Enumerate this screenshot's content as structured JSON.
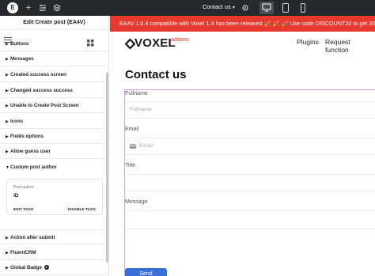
{
  "topbar": {
    "logo_letter": "E",
    "page_selector": "Contact us",
    "plus_icon": "+",
    "chevron": "▾"
  },
  "panel": {
    "title": "Edit Create post (EA4V)",
    "sections": [
      {
        "label": "Buttons"
      },
      {
        "label": "Messages"
      },
      {
        "label": "Created success screen"
      },
      {
        "label": "Changed success success"
      },
      {
        "label": "Unable to Create Post Screen"
      },
      {
        "label": "Icons"
      },
      {
        "label": "Fields options"
      },
      {
        "label": "Allow guess user"
      },
      {
        "label": "Custom post author",
        "expanded": true
      },
      {
        "label": "Action after submit"
      },
      {
        "label": "FluentCRM"
      },
      {
        "label": "Global Badge"
      }
    ],
    "card": {
      "label": "Post author",
      "value": "ID",
      "edit_tags": "EDIT TAGS",
      "disable_tags": "DISABLE TAGS"
    }
  },
  "preview": {
    "promo": "EA4V 1.0.4 compatible with Voxel 1.4 has been released 🎉 🎉 🎉  Use code DISCOUNT20 to get 20% OFF!",
    "logo_text": "VOXEL",
    "logo_sub": "addons",
    "nav": [
      "Plugins",
      "Request function"
    ],
    "page_title": "Contact us",
    "fields": [
      {
        "label": "Fullname",
        "placeholder": "Fullname"
      },
      {
        "label": "Email",
        "placeholder": "Email"
      },
      {
        "label": "Title",
        "placeholder": ""
      },
      {
        "label": "Message",
        "placeholder": ""
      }
    ],
    "send_label": "Send"
  },
  "colors": {
    "topbar": "#26292c",
    "promo": "#e8392f",
    "button": "#3a6fd8",
    "outline": "#d4a5e6"
  }
}
